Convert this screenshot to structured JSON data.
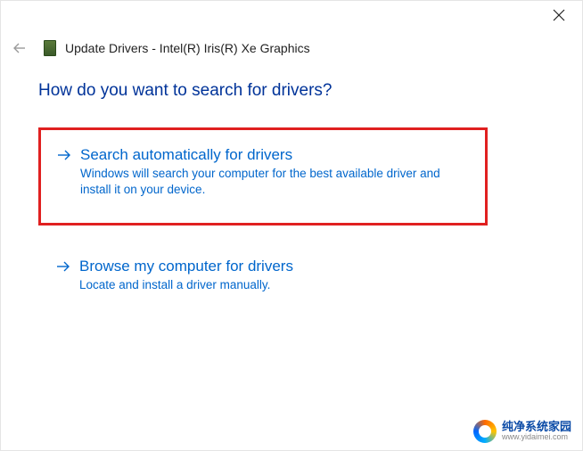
{
  "titlebar": {
    "close_label": "Close"
  },
  "header": {
    "back_label": "Back",
    "window_title": "Update Drivers - Intel(R) Iris(R) Xe Graphics"
  },
  "main": {
    "heading": "How do you want to search for drivers?",
    "options": [
      {
        "title": "Search automatically for drivers",
        "description": "Windows will search your computer for the best available driver and install it on your device.",
        "highlighted": true
      },
      {
        "title": "Browse my computer for drivers",
        "description": "Locate and install a driver manually.",
        "highlighted": false
      }
    ]
  },
  "watermark": {
    "text": "纯净系统家园",
    "url": "www.yidaimei.com"
  },
  "colors": {
    "link_blue": "#0066cc",
    "heading_blue": "#003399",
    "highlight_red": "#e02020"
  }
}
